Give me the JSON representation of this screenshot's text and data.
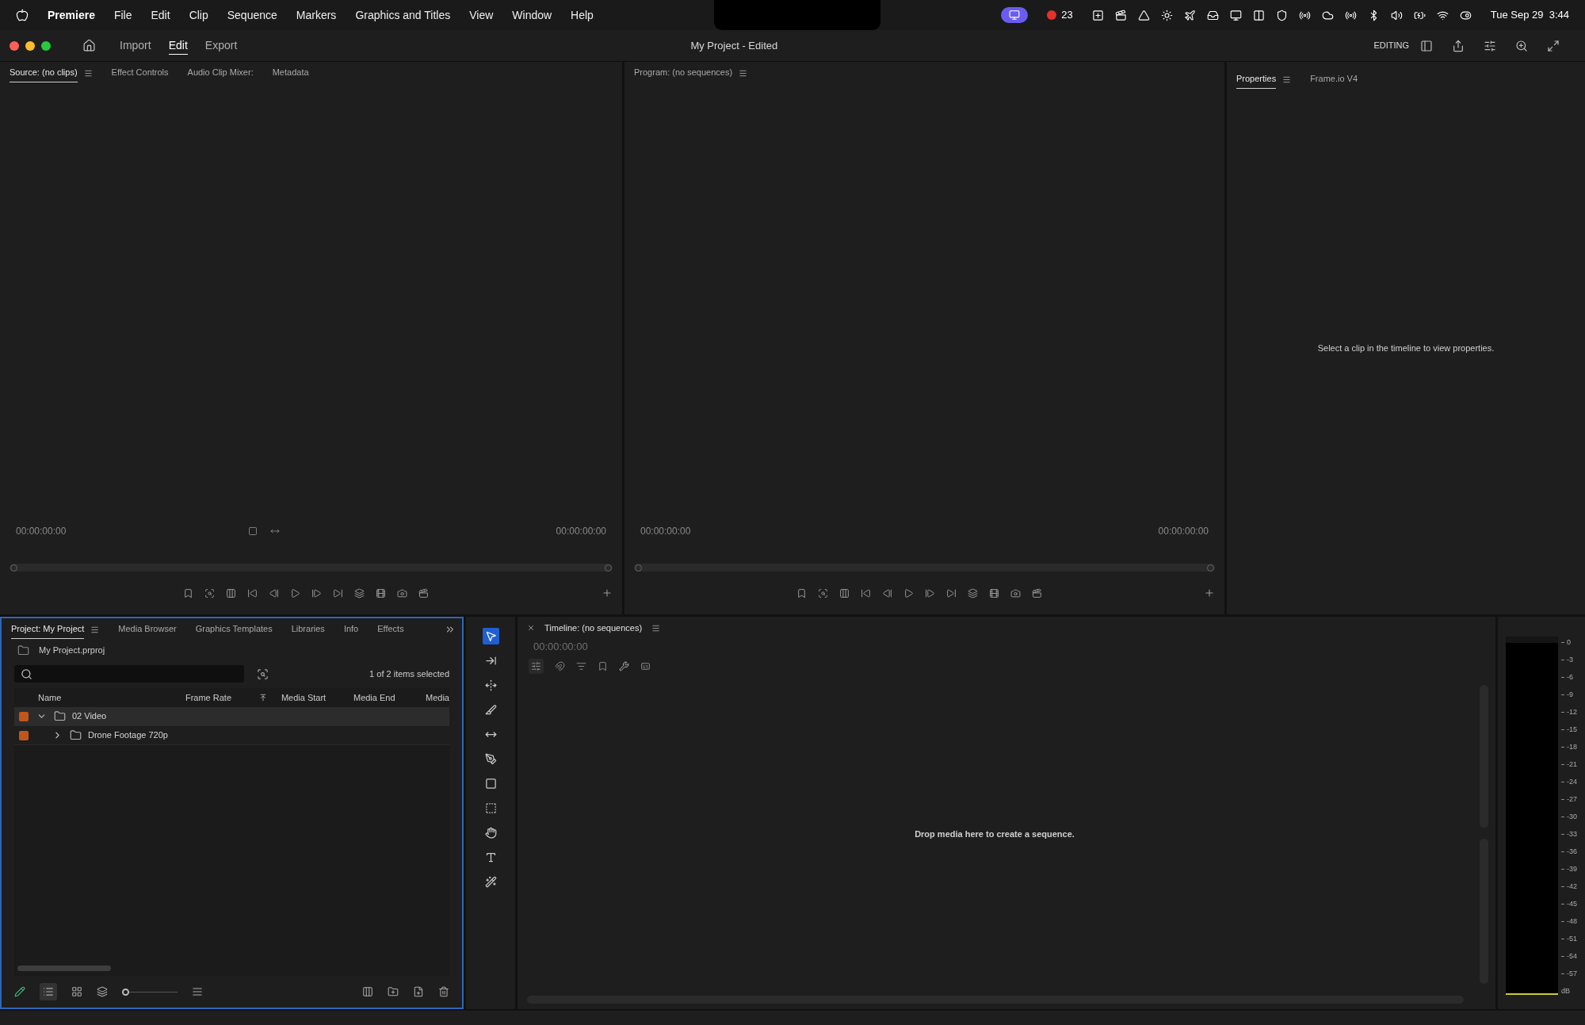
{
  "menubar": {
    "app": "Premiere",
    "items": [
      "File",
      "Edit",
      "Clip",
      "Sequence",
      "Markers",
      "Graphics and Titles",
      "View",
      "Window",
      "Help"
    ],
    "record_count": "23",
    "clock": "Tue Sep 29  3:44"
  },
  "title_bar": {
    "nav": [
      {
        "label": "Import",
        "selected": false
      },
      {
        "label": "Edit",
        "selected": true
      },
      {
        "label": "Export",
        "selected": false
      }
    ],
    "title": "My Project - Edited",
    "workspace": "EDITING"
  },
  "source_panel": {
    "tabs": [
      {
        "label": "Source: (no clips)",
        "selected": true,
        "menu": true
      },
      {
        "label": "Effect Controls",
        "selected": false,
        "menu": false
      },
      {
        "label": "Audio Clip Mixer:",
        "selected": false,
        "menu": false
      },
      {
        "label": "Metadata",
        "selected": false,
        "menu": false
      }
    ],
    "timecode_left": "00:00:00:00",
    "timecode_right": "00:00:00:00"
  },
  "program_panel": {
    "tabs": [
      {
        "label": "Program: (no sequences)",
        "selected": false,
        "menu": true
      }
    ],
    "timecode_left": "00:00:00:00",
    "timecode_right": "00:00:00:00"
  },
  "properties_panel": {
    "tabs": [
      {
        "label": "Properties",
        "selected": true,
        "menu": true
      },
      {
        "label": "Frame.io V4",
        "selected": false,
        "menu": false
      }
    ],
    "message": "Select a clip in the timeline to view properties."
  },
  "project_panel": {
    "tabs": [
      {
        "label": "Project: My Project",
        "selected": true,
        "menu": true
      },
      {
        "label": "Media Browser",
        "selected": false,
        "menu": false
      },
      {
        "label": "Graphics Templates",
        "selected": false,
        "menu": false
      },
      {
        "label": "Libraries",
        "selected": false,
        "menu": false
      },
      {
        "label": "Info",
        "selected": false,
        "menu": false
      },
      {
        "label": "Effects",
        "selected": false,
        "menu": false
      }
    ],
    "file": "My Project.prproj",
    "status": "1 of 2 items selected",
    "columns": [
      "Name",
      "Frame Rate",
      "Media Start",
      "Media End",
      "Media"
    ],
    "zoom_slider": {
      "level": 0
    },
    "rows": [
      {
        "name": "02 Video",
        "color": "#c0561c",
        "selected": true,
        "expanded": true,
        "children": [
          {
            "name": "Drone Footage 720p",
            "color": "#c0561c",
            "selected": false,
            "expanded": false
          }
        ]
      }
    ]
  },
  "tools": [
    {
      "kind": "selection",
      "selected": true
    },
    {
      "kind": "track-select",
      "selected": false
    },
    {
      "kind": "ripple",
      "selected": false
    },
    {
      "kind": "razor",
      "selected": false
    },
    {
      "kind": "slip",
      "selected": false
    },
    {
      "kind": "pen",
      "selected": false
    },
    {
      "kind": "rectangle",
      "selected": false
    },
    {
      "kind": "frame",
      "selected": false
    },
    {
      "kind": "hand",
      "selected": false
    },
    {
      "kind": "type",
      "selected": false
    },
    {
      "kind": "remix",
      "selected": false
    }
  ],
  "timeline": {
    "title": "Timeline: (no sequences)",
    "timecode": "00:00:00:00",
    "message": "Drop media here to create a sequence."
  },
  "meter": {
    "ticks": [
      "0",
      "-3",
      "-6",
      "-9",
      "-12",
      "-15",
      "-18",
      "-21",
      "-24",
      "-27",
      "-30",
      "-33",
      "-36",
      "-39",
      "-42",
      "-45",
      "-48",
      "-51",
      "-54",
      "-57"
    ],
    "unit": "dB"
  }
}
